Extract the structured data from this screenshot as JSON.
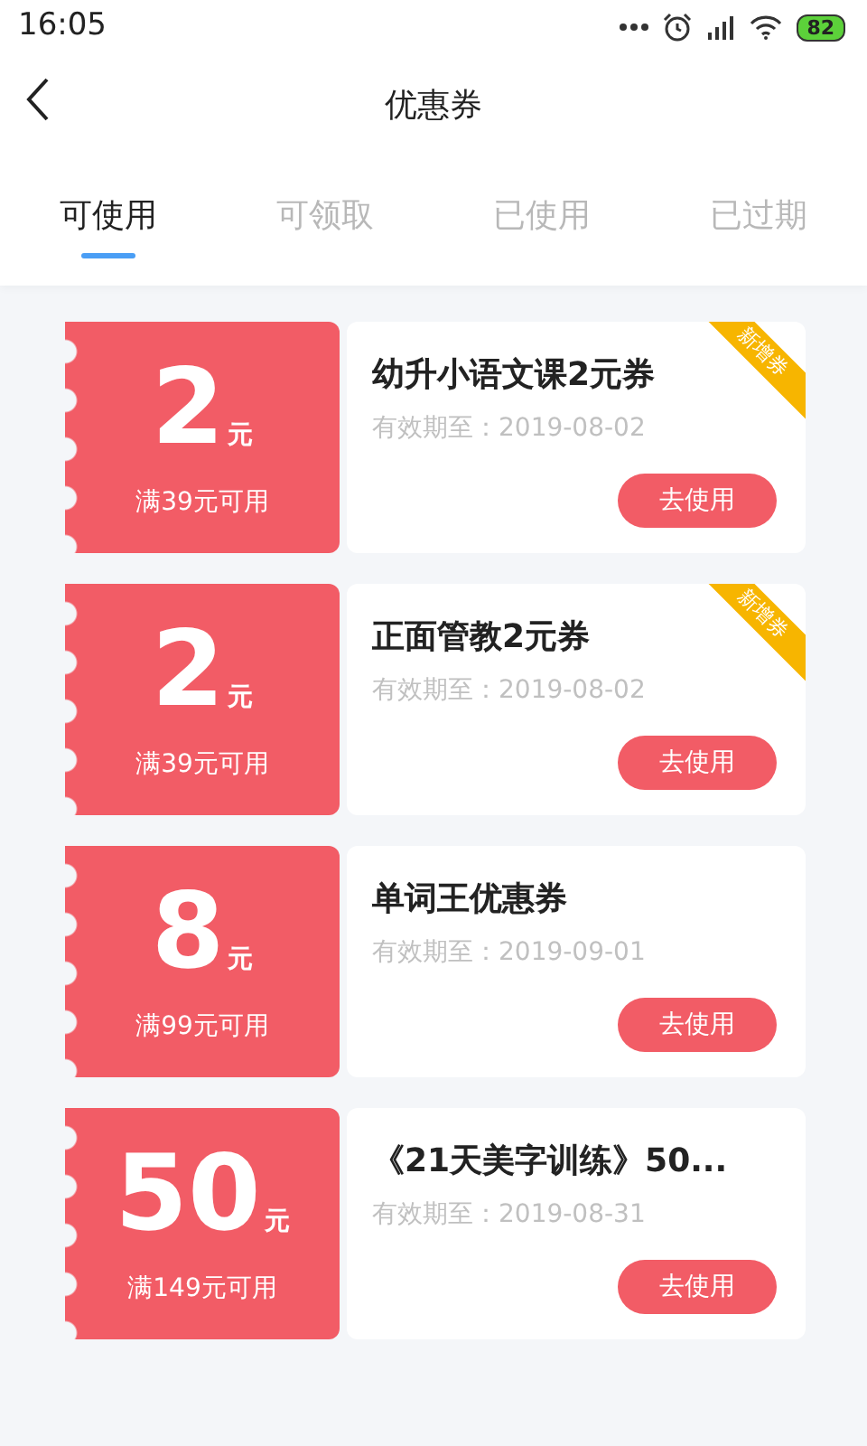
{
  "status_bar": {
    "time": "16:05",
    "battery": "82"
  },
  "header": {
    "title": "优惠券"
  },
  "tabs": [
    {
      "label": "可使用",
      "selected": true
    },
    {
      "label": "可领取",
      "selected": false
    },
    {
      "label": "已使用",
      "selected": false
    },
    {
      "label": "已过期",
      "selected": false
    }
  ],
  "coupons": [
    {
      "amount": "2",
      "unit": "元",
      "condition": "满39元可用",
      "name": "幼升小语文课2元券",
      "expiry": "有效期至：2019-08-02",
      "button": "去使用",
      "is_new": true,
      "new_label": "新增券"
    },
    {
      "amount": "2",
      "unit": "元",
      "condition": "满39元可用",
      "name": "正面管教2元券",
      "expiry": "有效期至：2019-08-02",
      "button": "去使用",
      "is_new": true,
      "new_label": "新增券"
    },
    {
      "amount": "8",
      "unit": "元",
      "condition": "满99元可用",
      "name": "单词王优惠券",
      "expiry": "有效期至：2019-09-01",
      "button": "去使用",
      "is_new": false
    },
    {
      "amount": "50",
      "unit": "元",
      "condition": "满149元可用",
      "name": "《21天美字训练》50...",
      "expiry": "有效期至：2019-08-31",
      "button": "去使用",
      "is_new": false
    }
  ]
}
